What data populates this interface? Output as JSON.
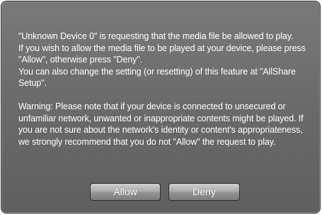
{
  "dialog": {
    "message": "\"Unknown Device 0\" is requesting that the media file be allowed to play.\nIf you wish to allow the media file to be played at your device, please press \"Allow\", otherwise press \"Deny\".\nYou can also change the setting (or resetting) of this feature at \"AllShare Setup\".",
    "warning": "Warning: Please note that if your device is connected to unsecured or unfamiliar network, unwanted or inappropriate contents might be played. If you are not sure about the network's identity or content's appropriateness, we strongly recommend that you do not \"Allow\" the request to play.",
    "allow_label": "Allow",
    "deny_label": "Deny"
  }
}
